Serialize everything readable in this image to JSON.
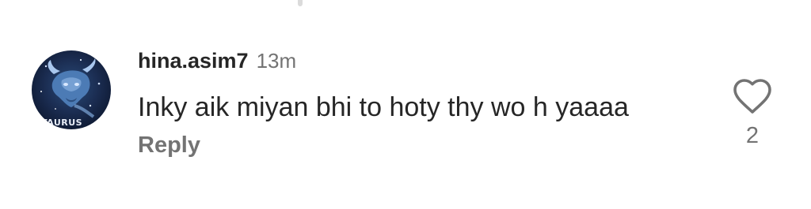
{
  "comment": {
    "username": "hina.asim7",
    "timestamp": "13m",
    "text": "Inky aik miyan bhi to hoty thy wo h yaaaa",
    "reply_label": "Reply",
    "like_count": "2",
    "avatar": {
      "icon": "taurus-bull-avatar",
      "label": "TAURUS"
    }
  },
  "colors": {
    "primary_text": "#262626",
    "secondary_text": "#737373",
    "avatar_bg": "#1b2d52"
  }
}
